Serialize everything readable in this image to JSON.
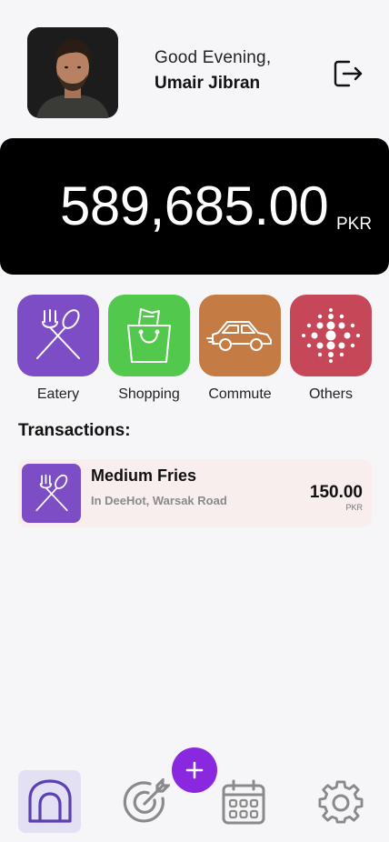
{
  "header": {
    "greeting": "Good Evening,",
    "user_name": "Umair Jibran",
    "avatar_icon": "user-avatar-photo",
    "logout_icon": "logout-icon"
  },
  "balance": {
    "amount": "589,685.00",
    "currency": "PKR"
  },
  "categories": [
    {
      "label": "Eatery",
      "color": "#7d4dc6",
      "icon": "fork-spoon-icon"
    },
    {
      "label": "Shopping",
      "color": "#52c94d",
      "icon": "shopping-bag-icon"
    },
    {
      "label": "Commute",
      "color": "#c47b44",
      "icon": "car-icon"
    },
    {
      "label": "Others",
      "color": "#c64758",
      "icon": "dots-pattern-icon"
    }
  ],
  "transactions": {
    "title": "Transactions:",
    "items": [
      {
        "title": "Medium Fries",
        "subtitle": "In DeeHot, Warsak Road",
        "amount": "150.00",
        "currency": "PKR",
        "icon": "fork-spoon-icon",
        "color": "#7d4dc6"
      }
    ]
  },
  "nav": {
    "items": [
      {
        "name": "home",
        "icon": "home-icon",
        "active": true
      },
      {
        "name": "goals",
        "icon": "target-icon",
        "active": false
      },
      {
        "name": "calendar",
        "icon": "calendar-icon",
        "active": false
      },
      {
        "name": "settings",
        "icon": "gear-icon",
        "active": false
      }
    ],
    "add_icon": "plus-icon",
    "accent": "#8a28e0"
  }
}
